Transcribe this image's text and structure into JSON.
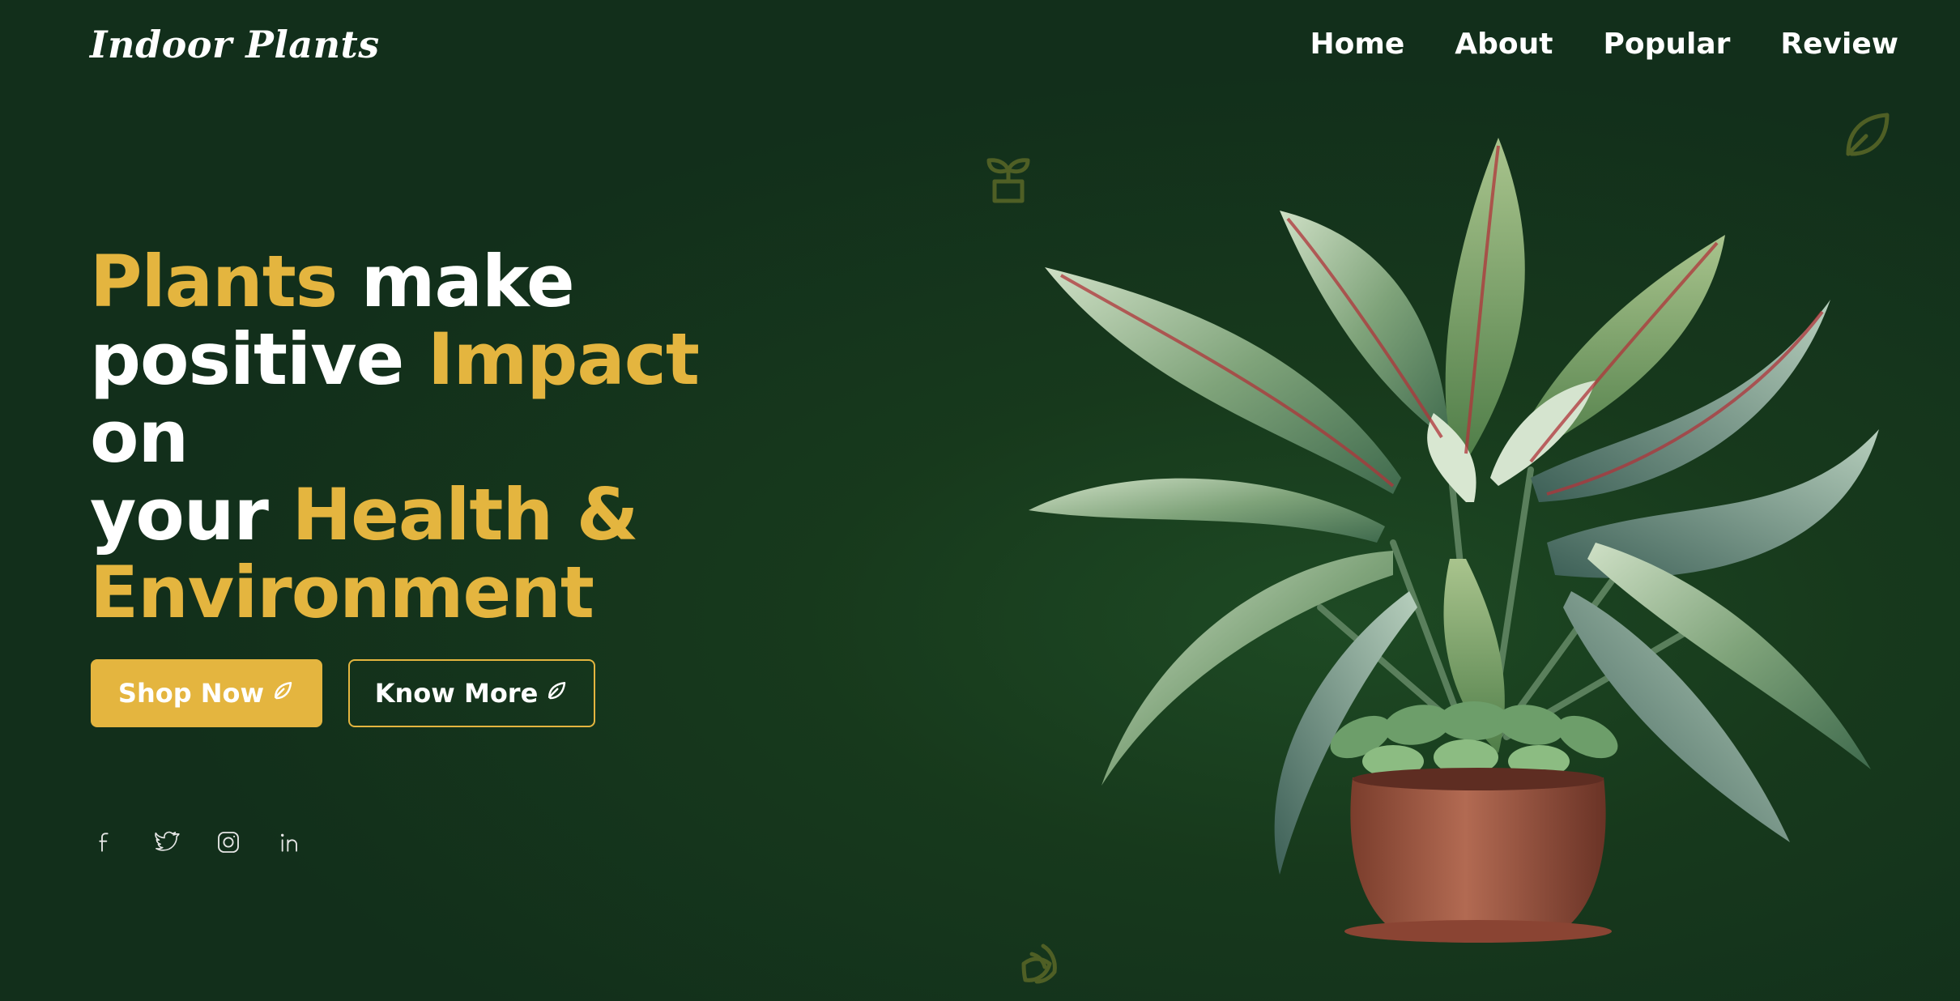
{
  "header": {
    "logo": "Indoor Plants",
    "nav": [
      {
        "label": "Home"
      },
      {
        "label": "About"
      },
      {
        "label": "Popular"
      },
      {
        "label": "Review"
      }
    ]
  },
  "hero": {
    "headline": {
      "w1": "Plants",
      "w2": " make",
      "w3": "positive ",
      "w4": "Impact",
      "w5": " on",
      "w6": "your ",
      "w7": "Health &",
      "w8": "Environment"
    },
    "buttons": {
      "primary": "Shop Now",
      "secondary": "Know More"
    }
  },
  "social": {
    "icons": [
      "facebook-icon",
      "twitter-icon",
      "instagram-icon",
      "linkedin-icon"
    ]
  },
  "colors": {
    "background": "#122f1b",
    "accent": "#e4b53f",
    "text": "#ffffff",
    "deco": "#4f5f25"
  }
}
